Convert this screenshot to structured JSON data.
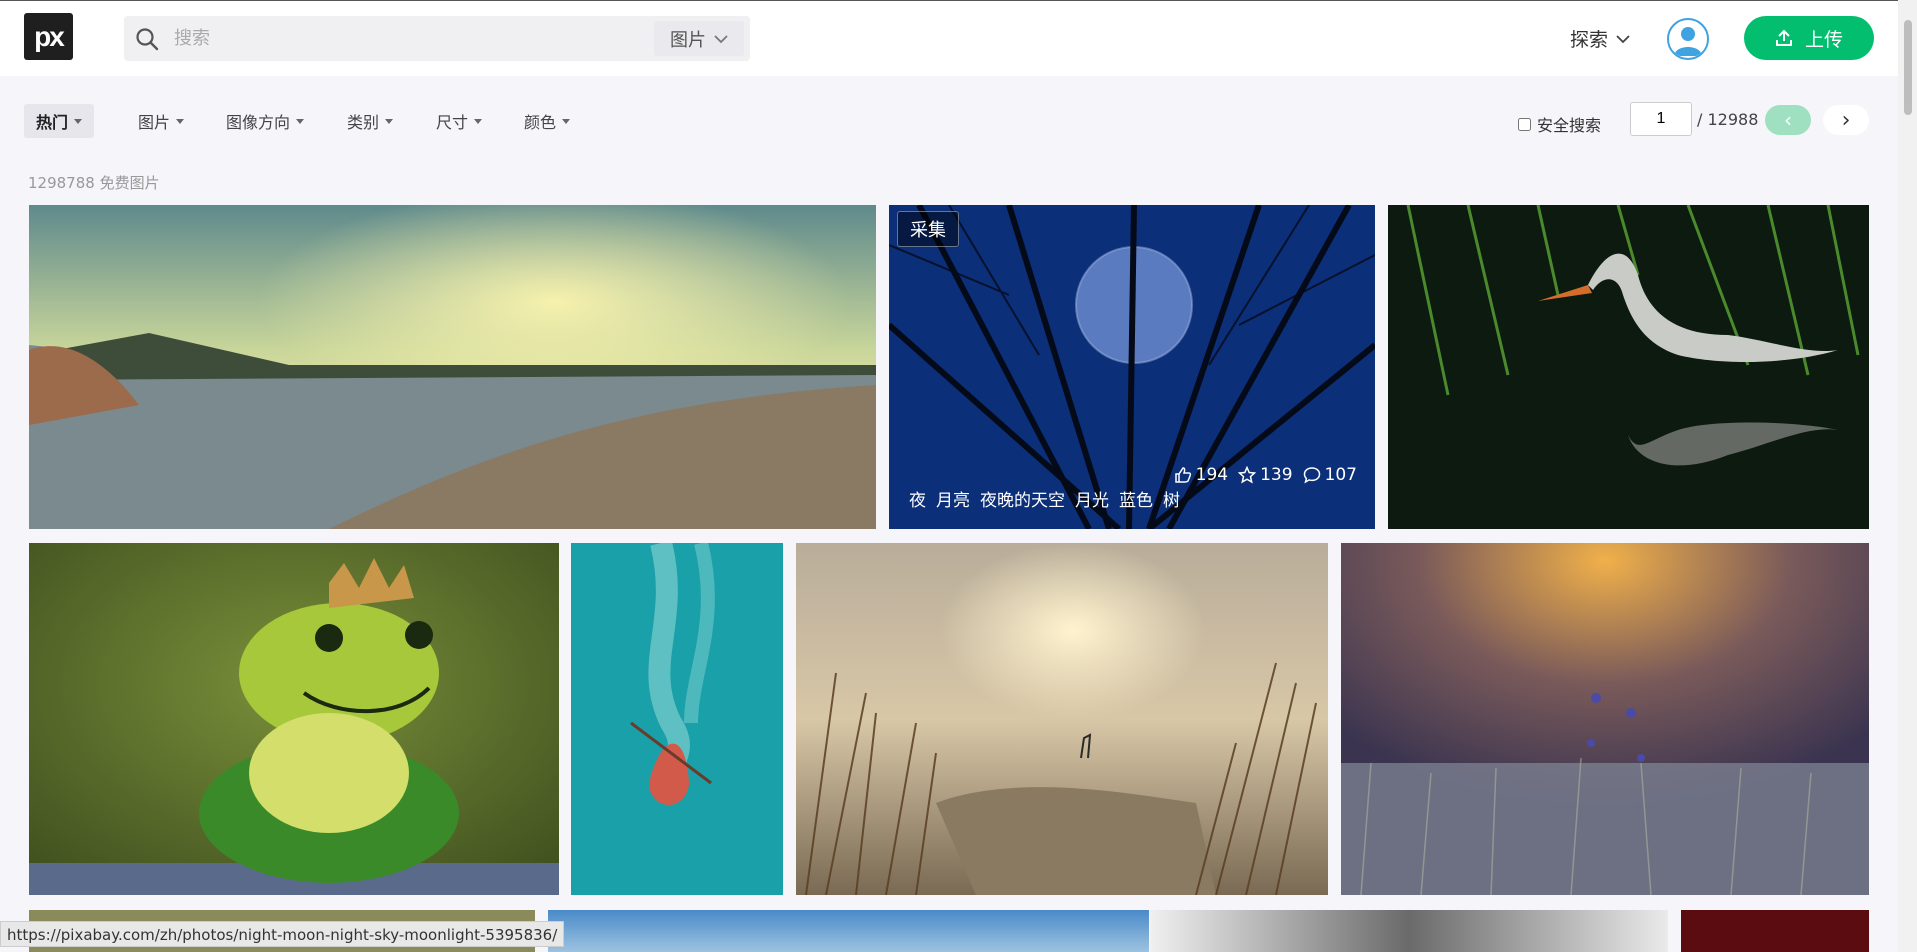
{
  "header": {
    "logo_text": "px",
    "search_placeholder": "搜索",
    "search_type": "图片",
    "explore_label": "探索",
    "upload_label": "上传"
  },
  "filters": {
    "items": [
      "热门",
      "图片",
      "图像方向",
      "类别",
      "尺寸",
      "颜色"
    ],
    "safe_search_label": "安全搜索",
    "page_current": "1",
    "page_total": "/ 12988",
    "prev_label": "‹",
    "next_label": "›"
  },
  "results": {
    "count_text": "1298788 免费图片"
  },
  "hover_photo": {
    "collect_label": "采集",
    "likes": "194",
    "favorites": "139",
    "comments": "107",
    "tags": [
      "夜",
      "月亮",
      "夜晚的天空",
      "月光",
      "蓝色",
      "树"
    ]
  },
  "photos": [
    {
      "name": "lake-sunset"
    },
    {
      "name": "night-moon-trees"
    },
    {
      "name": "heron-reeds"
    },
    {
      "name": "frog-king"
    },
    {
      "name": "red-boat"
    },
    {
      "name": "misty-heron-lake"
    },
    {
      "name": "cornflower-field"
    }
  ],
  "status_url": "https://pixabay.com/zh/photos/night-moon-night-sky-moonlight-5395836/",
  "colors": {
    "accent": "#02be6e",
    "header_bg": "#ffffff",
    "page_bg": "#f5f5fa"
  }
}
